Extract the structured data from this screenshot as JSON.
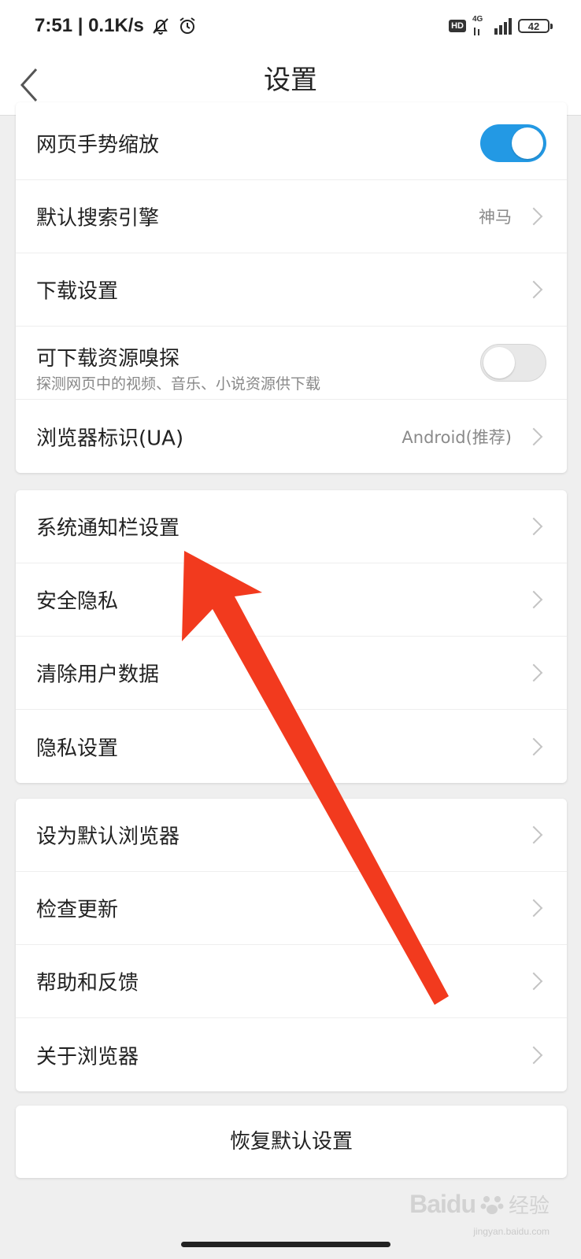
{
  "status_bar": {
    "time_speed": "7:51 | 0.1K/s",
    "hd": "HD",
    "network": "4G",
    "battery": "42"
  },
  "header": {
    "title": "设置"
  },
  "group1": {
    "gesture_zoom": {
      "label": "网页手势缩放",
      "toggle": "on"
    },
    "search_engine": {
      "label": "默认搜索引擎",
      "value": "神马"
    },
    "download_settings": {
      "label": "下载设置"
    },
    "resource_sniff": {
      "label": "可下载资源嗅探",
      "sublabel": "探测网页中的视频、音乐、小说资源供下载",
      "toggle": "off"
    },
    "user_agent": {
      "label": "浏览器标识(UA)",
      "value": "Android(推荐)"
    }
  },
  "group2": {
    "items": [
      "系统通知栏设置",
      "安全隐私",
      "清除用户数据",
      "隐私设置"
    ]
  },
  "group3": {
    "items": [
      "设为默认浏览器",
      "检查更新",
      "帮助和反馈",
      "关于浏览器"
    ]
  },
  "reset_button": "恢复默认设置",
  "watermark": {
    "brand": "Baidu",
    "cn": "经验",
    "url": "jingyan.baidu.com"
  },
  "colors": {
    "accent": "#2399e4",
    "arrow": "#f23a1e",
    "background": "#efefef"
  },
  "icons": {
    "back": "chevron-left-icon",
    "row_chevron": "chevron-right-icon"
  }
}
